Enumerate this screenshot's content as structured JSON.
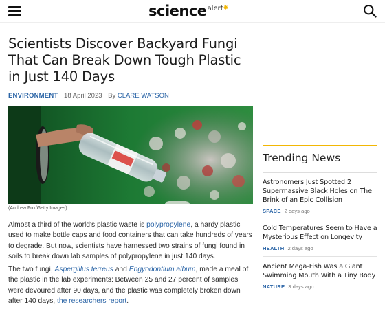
{
  "header": {
    "logo_main": "science",
    "logo_sub": "alert",
    "menu_icon": "hamburger-menu-icon",
    "search_icon": "search-icon"
  },
  "article": {
    "headline": "Scientists Discover Backyard Fungi That Can Break Down Tough Plastic in Just 140 Days",
    "category": "ENVIRONMENT",
    "date": "18 April 2023",
    "by": "By",
    "author": "CLARE WATSON",
    "image_credit": "(Andrew Fox/Getty Images)",
    "p1": {
      "before": "Almost a third of the world's plastic waste is ",
      "link": "polypropylene",
      "after": ", a hardy plastic used to make bottle caps and food containers that can take hundreds of years to degrade. But now, scientists have harnessed two strains of fungi found in soils to break down lab samples of polypropylene in just 140 days."
    },
    "p2": {
      "before": "The two fungi, ",
      "species1": "Aspergillus terreus",
      "and": " and ",
      "species2": "Engyodontium album",
      "middle": ", made a meal of the plastic in the lab experiments: Between 25 and 27 percent of samples were devoured after 90 days, and the plastic was completely broken down after 140 days, ",
      "link": "the researchers report",
      "end": "."
    }
  },
  "sidebar": {
    "title": "Trending News",
    "items": [
      {
        "title": "Astronomers Just Spotted 2 Supermassive Black Holes on The Brink of an Epic Collision",
        "category": "SPACE",
        "time": "2 days ago"
      },
      {
        "title": "Cold Temperatures Seem to Have a Mysterious Effect on Longevity",
        "category": "HEALTH",
        "time": "2 days ago"
      },
      {
        "title": "Ancient Mega-Fish Was a Giant Swimming Mouth With a Tiny Body",
        "category": "NATURE",
        "time": "3 days ago"
      }
    ]
  },
  "colors": {
    "link": "#2a64a6",
    "accent": "#f2b705",
    "text": "#1a1a1a",
    "meta": "#666666"
  }
}
